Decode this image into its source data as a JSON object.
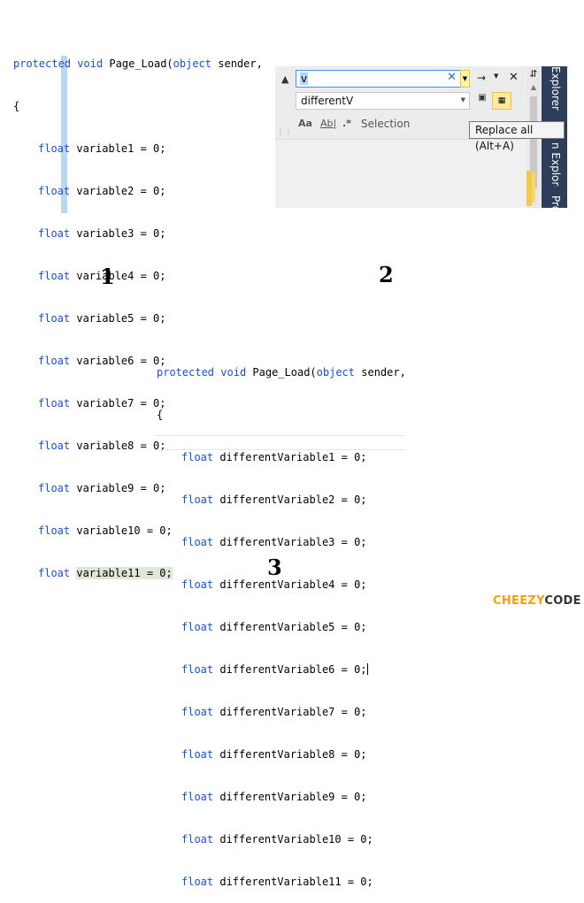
{
  "panel1": {
    "header": "Page_Load(object sender,",
    "kw_protected": "protected",
    "kw_void": "void",
    "kw_object": "object",
    "brace": "{",
    "lines": [
      {
        "type": "float",
        "rest": "variable1 = 0;"
      },
      {
        "type": "float",
        "rest": "variable2 = 0;"
      },
      {
        "type": "float",
        "rest": "variable3 = 0;"
      },
      {
        "type": "float",
        "rest": "variable4 = 0;"
      },
      {
        "type": "float",
        "rest": "variable5 = 0;"
      },
      {
        "type": "float",
        "rest": "variable6 = 0;"
      },
      {
        "type": "float",
        "rest": "variable7 = 0;"
      },
      {
        "type": "float",
        "rest": "variable8 = 0;"
      },
      {
        "type": "float",
        "rest": "variable9 = 0;"
      },
      {
        "type": "float",
        "rest": "variable10 = 0;"
      },
      {
        "type": "float",
        "rest": "variable11 = 0;"
      }
    ]
  },
  "findpanel": {
    "find_value": "v",
    "replace_value": "differentV",
    "opt_case": "Aa",
    "opt_word": "Ab|",
    "opt_regex": ".*",
    "scope": "Selection",
    "tooltip": "Replace all (Alt+A)",
    "side_tab_1": "Explorer",
    "side_tab_2": "n Explorer",
    "side_tab_3": "Pro"
  },
  "panel3": {
    "header": "Page_Load(object sender,",
    "kw_protected": "protected",
    "kw_void": "void",
    "kw_object": "object",
    "brace": "{",
    "lines": [
      {
        "type": "float",
        "rest": "differentVariable1 = 0;"
      },
      {
        "type": "float",
        "rest": "differentVariable2 = 0;"
      },
      {
        "type": "float",
        "rest": "differentVariable3 = 0;"
      },
      {
        "type": "float",
        "rest": "differentVariable4 = 0;"
      },
      {
        "type": "float",
        "rest": "differentVariable5 = 0;"
      },
      {
        "type": "float",
        "rest": "differentVariable6 = 0;"
      },
      {
        "type": "float",
        "rest": "differentVariable7 = 0;"
      },
      {
        "type": "float",
        "rest": "differentVariable8 = 0;"
      },
      {
        "type": "float",
        "rest": "differentVariable9 = 0;"
      },
      {
        "type": "float",
        "rest": "differentVariable10 = 0;"
      },
      {
        "type": "float",
        "rest": "differentVariable11 = 0;"
      }
    ]
  },
  "steps": {
    "one": "1",
    "two": "2",
    "three": "3"
  },
  "brand": {
    "part1": "CHEEZY",
    "part2": "CODE"
  },
  "colors": {
    "keyword": "#1a4fd0",
    "brand_accent": "#f0a30a",
    "selection": "#b9d7f0"
  }
}
